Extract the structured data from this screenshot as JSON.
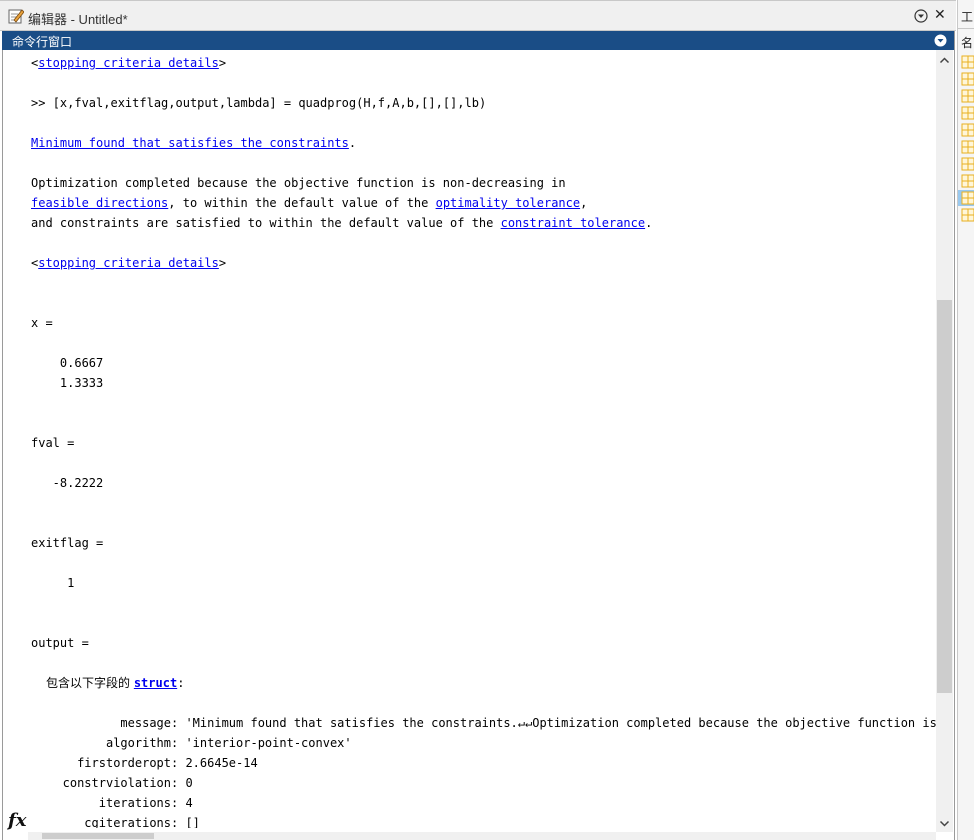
{
  "editor_bar": {
    "title": "编辑器 - Untitled*"
  },
  "command_window": {
    "title": "命令行窗口"
  },
  "console": {
    "stopping_link_1": "stopping criteria details",
    "command_prompt": ">> ",
    "command_text": "[x,fval,exitflag,output,lambda] = quadprog(H,f,A,b,[],[],lb)",
    "min_found_link": "Minimum found that satisfies the constraints",
    "min_found_period": ".",
    "opt_line_1": "Optimization completed because the objective function is non-decreasing in",
    "feasible_link": "feasible directions",
    "opt_line_2_mid": ", to within the default value of the ",
    "optimality_link": "optimality tolerance",
    "opt_line_2_end": ",",
    "opt_line_3_start": "and constraints are satisfied to within the default value of the ",
    "constraint_link": "constraint tolerance",
    "opt_line_3_end": ".",
    "stopping_link_2": "stopping criteria details",
    "x_label": "x =",
    "x_val_1": "    0.6667",
    "x_val_2": "    1.3333",
    "fval_label": "fval =",
    "fval_val": "   -8.2222",
    "exitflag_label": "exitflag =",
    "exitflag_val": "     1",
    "output_label": "output =",
    "struct_prefix": "包含以下字段的 ",
    "struct_link": "struct",
    "struct_colon": ":",
    "fields": [
      {
        "name": "message",
        "value": "'Minimum found that satisfies the constraints.↵↵Optimization completed because the objective function is no"
      },
      {
        "name": "algorithm",
        "value": "'interior-point-convex'"
      },
      {
        "name": "firstorderopt",
        "value": "2.6645e-14"
      },
      {
        "name": "constrviolation",
        "value": "0"
      },
      {
        "name": "iterations",
        "value": "4"
      },
      {
        "name": "cgiterations",
        "value": "[]"
      }
    ]
  },
  "prompt_icon": "fx",
  "workspace_panel": {
    "header": "工",
    "column": "名"
  },
  "icons": {
    "pencil": "edit-pencil-icon",
    "panel_menu": "circle-down-icon",
    "close": "close-icon",
    "variable": "grid-variable-icon"
  },
  "colors": {
    "header_bg": "#1a4d86",
    "link": "#0000ee",
    "variable_icon": "#e8b020"
  }
}
